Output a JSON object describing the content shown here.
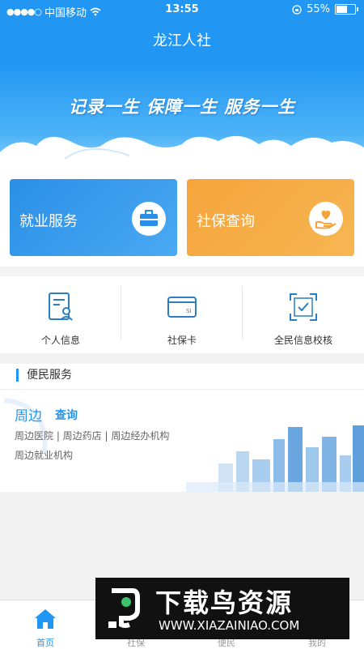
{
  "status_bar": {
    "carrier": "中国移动",
    "time": "13:55",
    "battery": "55%"
  },
  "header": {
    "title": "龙江人社"
  },
  "banner": {
    "slogan": "记录一生  保障一生  服务一生"
  },
  "cards": [
    {
      "label": "就业服务",
      "icon": "toolbox-icon",
      "color": "#2a8fe6"
    },
    {
      "label": "社保查询",
      "icon": "hand-heart-icon",
      "color": "#f5a43b"
    }
  ],
  "quick_links": [
    {
      "label": "个人信息",
      "icon": "personal-info-icon"
    },
    {
      "label": "社保卡",
      "icon": "si-card-icon"
    },
    {
      "label": "全民信息校核",
      "icon": "verify-scan-icon"
    }
  ],
  "section": {
    "title": "便民服务",
    "heading": "周边",
    "action": "查询",
    "line1": "周边医院 | 周边药店 | 周边经办机构",
    "line2": "周边就业机构"
  },
  "tabs": [
    {
      "label": "首页",
      "active": true
    },
    {
      "label": "社保",
      "active": false
    },
    {
      "label": "便民",
      "active": false
    },
    {
      "label": "我的",
      "active": false
    }
  ],
  "watermark": {
    "title": "下载鸟资源",
    "url": "WWW.XIAZAINIAO.COM"
  },
  "colors": {
    "primary": "#2196f3",
    "orange": "#f5a43b"
  }
}
